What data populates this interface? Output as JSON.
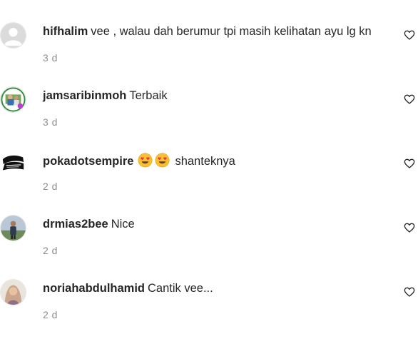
{
  "comments": [
    {
      "username": "hifhalim",
      "text": "vee , walau dah berumur tpi masih kelihatan ayu lg kn",
      "time": "3 d",
      "avatar_icon": "default-avatar-icon"
    },
    {
      "username": "jamsaribinmoh",
      "text": "Terbaik",
      "time": "3 d",
      "avatar_icon": "profile-photo"
    },
    {
      "username": "pokadotsempire",
      "emojis": [
        "heart-eyes-emoji",
        "heart-eyes-emoji"
      ],
      "text": "shanteknya",
      "time": "2 d",
      "avatar_icon": "brand-logo"
    },
    {
      "username": "drmias2bee",
      "text": "Nice",
      "time": "2 d",
      "avatar_icon": "profile-photo"
    },
    {
      "username": "noriahabdulhamid",
      "text": "Cantik vee...",
      "time": "2 d",
      "avatar_icon": "profile-photo"
    }
  ],
  "like_icon": "heart-outline-icon",
  "colors": {
    "username": "#262626",
    "text": "#262626",
    "timestamp": "#8e8e8e",
    "background": "#ffffff"
  }
}
